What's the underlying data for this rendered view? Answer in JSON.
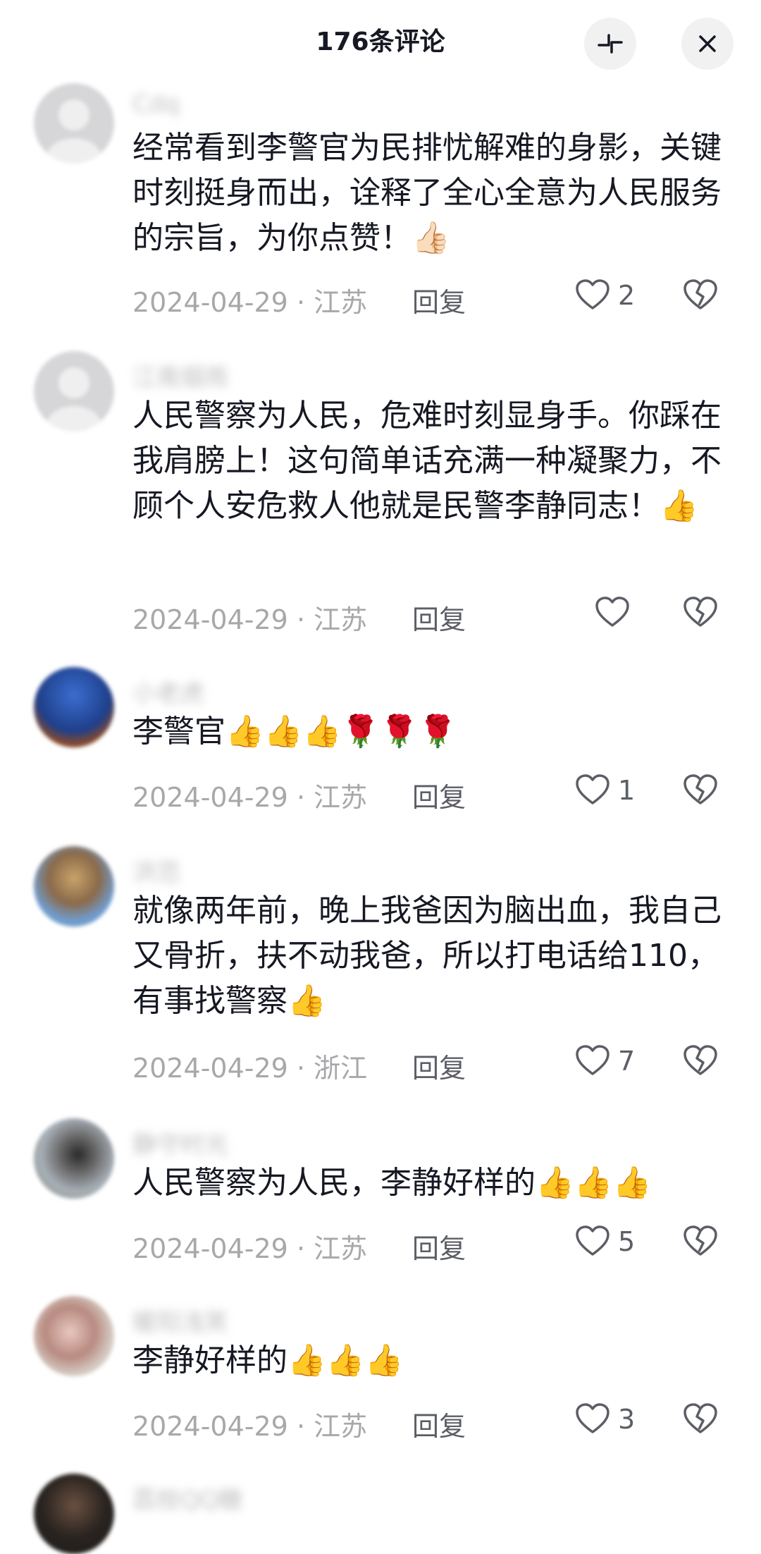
{
  "header": {
    "title": "176条评论",
    "shrink_icon": "collapse-icon",
    "close_icon": "close-icon"
  },
  "comments": [
    {
      "username": "Cdq",
      "text": "经常看到李警官为民排忧解难的身影，关键时刻挺身而出，诠释了全心全意为人民服务的宗旨，为你点赞！👍🏻",
      "date": "2024-04-29",
      "location": "江苏",
      "reply": "回复",
      "likes": "2"
    },
    {
      "username": "江南烟雨",
      "text": "人民警察为人民，危难时刻显身手。你踩在我肩膀上！这句简单话充满一种凝聚力，不顾个人安危救人他就是民警李静同志！👍",
      "date": "2024-04-29",
      "location": "江苏",
      "reply": "回复",
      "likes": ""
    },
    {
      "username": "小老虎",
      "text": "李警官👍👍👍🌹🌹🌹",
      "date": "2024-04-29",
      "location": "江苏",
      "reply": "回复",
      "likes": "1"
    },
    {
      "username": "洪范",
      "text": "就像两年前，晚上我爸因为脑出血，我自己又骨折，扶不动我爸，所以打电话给110，有事找警察👍",
      "date": "2024-04-29",
      "location": "浙江",
      "reply": "回复",
      "likes": "7"
    },
    {
      "username": "静守时光",
      "text": "人民警察为人民，李静好样的👍👍👍",
      "date": "2024-04-29",
      "location": "江苏",
      "reply": "回复",
      "likes": "5"
    },
    {
      "username": "暖阳浅笑",
      "text": "李静好样的👍👍👍",
      "date": "2024-04-29",
      "location": "江苏",
      "reply": "回复",
      "likes": "3"
    },
    {
      "username": "荔枝QQ糖",
      "text": "",
      "date": "",
      "location": "",
      "reply": "",
      "likes": ""
    }
  ],
  "colors": {
    "text": "#161823",
    "meta": "#a8a8ab",
    "button_bg": "#f1f1f2"
  }
}
